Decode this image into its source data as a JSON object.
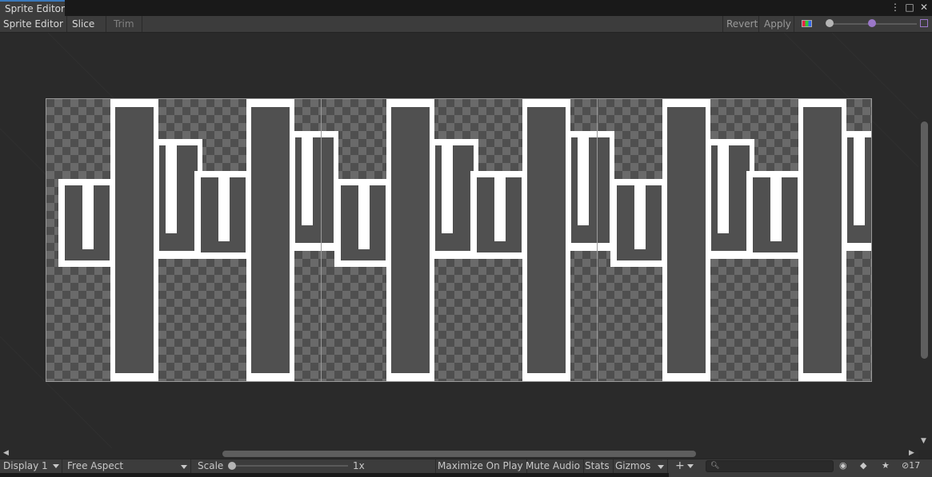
{
  "window": {
    "tab_title": "Sprite Editor",
    "controls": {
      "menu": "⋮",
      "maximize": "□",
      "close": "✕"
    }
  },
  "toolbar": {
    "mode_label": "Sprite Editor",
    "slice_label": "Slice",
    "trim_label": "Trim",
    "revert_label": "Revert",
    "apply_label": "Apply",
    "zoom_level": 0.0,
    "mip_level": 0.5
  },
  "canvas": {
    "sprite_frames": 3,
    "colors": {
      "checker_dark": "#4f4f4f",
      "checker_light": "#6a6a6a",
      "cactus_fill": "#505050",
      "outline": "#ffffff"
    }
  },
  "scrollbars": {
    "vertical": {
      "position": 0.3
    },
    "horizontal": {
      "position": 0.3
    }
  },
  "game_bar": {
    "display": "Display 1",
    "aspect": "Free Aspect",
    "scale_label": "Scale",
    "scale_value": "1x",
    "maximize_on_play": "Maximize On Play",
    "mute_audio": "Mute Audio",
    "stats": "Stats",
    "gizmos": "Gizmos",
    "add_label": "+",
    "layer_count": "17"
  },
  "icons": [
    "menu-icon",
    "maximize-icon",
    "close-icon",
    "color-channel-icon",
    "mipmap-icon",
    "search-icon",
    "scene-visibility-icon",
    "tag-icon",
    "star-icon",
    "hidden-count-icon"
  ]
}
